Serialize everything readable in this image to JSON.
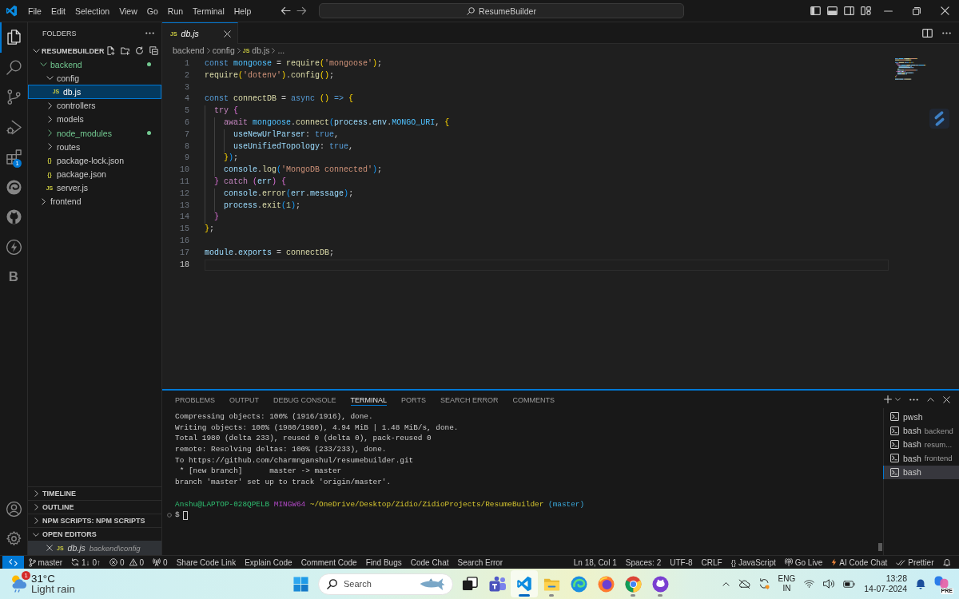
{
  "title_bar": {
    "menu": [
      "File",
      "Edit",
      "Selection",
      "View",
      "Go",
      "Run",
      "Terminal",
      "Help"
    ],
    "search": "ResumeBuilder"
  },
  "activity_bar": {
    "items": [
      {
        "kind": "explorer",
        "selected": true
      },
      {
        "kind": "search",
        "selected": false
      },
      {
        "kind": "source_control",
        "selected": false
      },
      {
        "kind": "run_debug",
        "selected": false
      },
      {
        "kind": "extensions",
        "selected": false,
        "badge": "1"
      },
      {
        "kind": "browser",
        "selected": false
      },
      {
        "kind": "github",
        "selected": false
      },
      {
        "kind": "lightning",
        "selected": false
      },
      {
        "kind": "letter",
        "label": "B",
        "selected": false
      }
    ],
    "bottom": [
      {
        "kind": "account"
      },
      {
        "kind": "settings"
      }
    ]
  },
  "sidebar": {
    "title": "FOLDERS",
    "root": {
      "label": "RESUMEBUILDER",
      "expanded": true
    },
    "tree": [
      {
        "kind": "folder",
        "label": "backend",
        "expanded": true,
        "untracked": true,
        "selected": false,
        "children": [
          {
            "kind": "folder",
            "label": "config",
            "expanded": true,
            "untracked": false,
            "selected": false,
            "children": [
              {
                "kind": "file",
                "icon": "JS",
                "label": "db.js",
                "untracked": false,
                "selected": true
              }
            ]
          },
          {
            "kind": "folder",
            "label": "controllers",
            "expanded": false,
            "untracked": false,
            "selected": false
          },
          {
            "kind": "folder",
            "label": "models",
            "expanded": false,
            "untracked": false,
            "selected": false
          },
          {
            "kind": "folder",
            "label": "node_modules",
            "expanded": false,
            "untracked": true,
            "selected": false
          },
          {
            "kind": "folder",
            "label": "routes",
            "expanded": false,
            "untracked": false,
            "selected": false
          },
          {
            "kind": "file",
            "icon": "{}",
            "label": "package-lock.json",
            "untracked": false,
            "selected": false
          },
          {
            "kind": "file",
            "icon": "{}",
            "label": "package.json",
            "untracked": false,
            "selected": false
          },
          {
            "kind": "file",
            "icon": "JS",
            "label": "server.js",
            "untracked": false,
            "selected": false
          }
        ]
      },
      {
        "kind": "folder",
        "label": "frontend",
        "expanded": false,
        "untracked": false,
        "selected": false
      }
    ],
    "sections": [
      {
        "label": "TIMELINE",
        "expanded": false
      },
      {
        "label": "OUTLINE",
        "expanded": false
      },
      {
        "label": "NPM SCRIPTS: NPM SCRIPTS",
        "expanded": false
      },
      {
        "label": "OPEN EDITORS",
        "expanded": true,
        "items": [
          {
            "icon": "JS",
            "label": "db.js",
            "path": "backend\\config",
            "preview": true,
            "selected": true
          }
        ]
      }
    ]
  },
  "editor": {
    "tabs": [
      {
        "icon": "JS",
        "label": "db.js",
        "preview": true,
        "selected": true
      }
    ],
    "breadcrumbs": [
      {
        "label": "backend"
      },
      {
        "label": "config"
      },
      {
        "icon": "JS",
        "label": "db.js"
      },
      {
        "label": "..."
      }
    ],
    "lines": [
      {
        "number": "1",
        "current": false,
        "tokens": [
          {
            "text": "const",
            "kind": "keyword"
          },
          {
            "text": " mongoose",
            "kind": "constant"
          },
          {
            "text": " = ",
            "kind": "punctuation"
          },
          {
            "text": "require",
            "kind": "function"
          },
          {
            "text": "(",
            "kind": "bracket1"
          },
          {
            "text": "'mongoose'",
            "kind": "string"
          },
          {
            "text": ")",
            "kind": "bracket1"
          },
          {
            "text": ";",
            "kind": "punctuation"
          }
        ]
      },
      {
        "number": "2",
        "current": false,
        "tokens": [
          {
            "text": "require",
            "kind": "function"
          },
          {
            "text": "(",
            "kind": "bracket1"
          },
          {
            "text": "'dotenv'",
            "kind": "string"
          },
          {
            "text": ")",
            "kind": "bracket1"
          },
          {
            "text": ".",
            "kind": "punctuation"
          },
          {
            "text": "config",
            "kind": "function"
          },
          {
            "text": "()",
            "kind": "bracket1"
          },
          {
            "text": ";",
            "kind": "punctuation"
          }
        ]
      },
      {
        "number": "3",
        "current": false
      },
      {
        "number": "4",
        "current": false,
        "tokens": [
          {
            "text": "const",
            "kind": "keyword"
          },
          {
            "text": " connectDB",
            "kind": "function"
          },
          {
            "text": " = ",
            "kind": "punctuation"
          },
          {
            "text": "async",
            "kind": "keyword"
          },
          {
            "text": " ()",
            "kind": "bracket1"
          },
          {
            "text": " =>",
            "kind": "keyword"
          },
          {
            "text": " {",
            "kind": "bracket1"
          }
        ]
      },
      {
        "number": "5",
        "current": false,
        "tokens": [
          {
            "text": "  try",
            "kind": "control"
          },
          {
            "text": " {",
            "kind": "bracket2"
          }
        ]
      },
      {
        "number": "6",
        "current": false,
        "tokens": [
          {
            "text": "    await",
            "kind": "control"
          },
          {
            "text": " mongoose",
            "kind": "constant"
          },
          {
            "text": ".",
            "kind": "punctuation"
          },
          {
            "text": "connect",
            "kind": "function"
          },
          {
            "text": "(",
            "kind": "bracket3"
          },
          {
            "text": "process",
            "kind": "variable"
          },
          {
            "text": ".",
            "kind": "punctuation"
          },
          {
            "text": "env",
            "kind": "variable"
          },
          {
            "text": ".",
            "kind": "punctuation"
          },
          {
            "text": "MONGO_URI",
            "kind": "constant"
          },
          {
            "text": ", ",
            "kind": "punctuation"
          },
          {
            "text": "{",
            "kind": "bracket1"
          }
        ]
      },
      {
        "number": "7",
        "current": false,
        "tokens": [
          {
            "text": "      useNewUrlParser",
            "kind": "variable"
          },
          {
            "text": ": ",
            "kind": "punctuation"
          },
          {
            "text": "true",
            "kind": "keyword"
          },
          {
            "text": ",",
            "kind": "punctuation"
          }
        ]
      },
      {
        "number": "8",
        "current": false,
        "tokens": [
          {
            "text": "      useUnifiedTopology",
            "kind": "variable"
          },
          {
            "text": ": ",
            "kind": "punctuation"
          },
          {
            "text": "true",
            "kind": "keyword"
          },
          {
            "text": ",",
            "kind": "punctuation"
          }
        ]
      },
      {
        "number": "9",
        "current": false,
        "tokens": [
          {
            "text": "    }",
            "kind": "bracket1"
          },
          {
            "text": ")",
            "kind": "bracket3"
          },
          {
            "text": ";",
            "kind": "punctuation"
          }
        ]
      },
      {
        "number": "10",
        "current": false,
        "tokens": [
          {
            "text": "    console",
            "kind": "variable"
          },
          {
            "text": ".",
            "kind": "punctuation"
          },
          {
            "text": "log",
            "kind": "function"
          },
          {
            "text": "(",
            "kind": "bracket3"
          },
          {
            "text": "'MongoDB connected'",
            "kind": "string"
          },
          {
            "text": ")",
            "kind": "bracket3"
          },
          {
            "text": ";",
            "kind": "punctuation"
          }
        ]
      },
      {
        "number": "11",
        "current": false,
        "tokens": [
          {
            "text": "  }",
            "kind": "bracket2"
          },
          {
            "text": " catch",
            "kind": "control"
          },
          {
            "text": " (",
            "kind": "bracket2"
          },
          {
            "text": "err",
            "kind": "variable"
          },
          {
            "text": ")",
            "kind": "bracket2"
          },
          {
            "text": " {",
            "kind": "bracket2"
          }
        ]
      },
      {
        "number": "12",
        "current": false,
        "tokens": [
          {
            "text": "    console",
            "kind": "variable"
          },
          {
            "text": ".",
            "kind": "punctuation"
          },
          {
            "text": "error",
            "kind": "function"
          },
          {
            "text": "(",
            "kind": "bracket3"
          },
          {
            "text": "err",
            "kind": "variable"
          },
          {
            "text": ".",
            "kind": "punctuation"
          },
          {
            "text": "message",
            "kind": "variable"
          },
          {
            "text": ")",
            "kind": "bracket3"
          },
          {
            "text": ";",
            "kind": "punctuation"
          }
        ]
      },
      {
        "number": "13",
        "current": false,
        "tokens": [
          {
            "text": "    process",
            "kind": "variable"
          },
          {
            "text": ".",
            "kind": "punctuation"
          },
          {
            "text": "exit",
            "kind": "function"
          },
          {
            "text": "(",
            "kind": "bracket3"
          },
          {
            "text": "1",
            "kind": "number"
          },
          {
            "text": ")",
            "kind": "bracket3"
          },
          {
            "text": ";",
            "kind": "punctuation"
          }
        ]
      },
      {
        "number": "14",
        "current": false,
        "tokens": [
          {
            "text": "  }",
            "kind": "bracket2"
          }
        ]
      },
      {
        "number": "15",
        "current": false,
        "tokens": [
          {
            "text": "}",
            "kind": "bracket1"
          },
          {
            "text": ";",
            "kind": "punctuation"
          }
        ]
      },
      {
        "number": "16",
        "current": false
      },
      {
        "number": "17",
        "current": false,
        "tokens": [
          {
            "text": "module",
            "kind": "variable"
          },
          {
            "text": ".",
            "kind": "punctuation"
          },
          {
            "text": "exports",
            "kind": "variable"
          },
          {
            "text": " = ",
            "kind": "punctuation"
          },
          {
            "text": "connectDB",
            "kind": "function"
          },
          {
            "text": ";",
            "kind": "punctuation"
          }
        ]
      },
      {
        "number": "18",
        "current": true
      }
    ]
  },
  "panel": {
    "tabs": [
      {
        "label": "PROBLEMS",
        "selected": false
      },
      {
        "label": "OUTPUT",
        "selected": false
      },
      {
        "label": "DEBUG CONSOLE",
        "selected": false
      },
      {
        "label": "TERMINAL",
        "selected": true
      },
      {
        "label": "PORTS",
        "selected": false
      },
      {
        "label": "SEARCH ERROR",
        "selected": false
      },
      {
        "label": "COMMENTS",
        "selected": false
      }
    ],
    "terminal": {
      "output": [
        "Compressing objects: 100% (1916/1916), done.",
        "Writing objects: 100% (1980/1980), 4.94 MiB | 1.48 MiB/s, done.",
        "Total 1980 (delta 233), reused 0 (delta 0), pack-reused 0",
        "remote: Resolving deltas: 100% (233/233), done.",
        "To https://github.com/charmnganshul/resumebuilder.git",
        " * [new branch]      master -> master",
        "branch 'master' set up to track 'origin/master'."
      ],
      "prompt": {
        "user": "Anshu@LAPTOP-028QPELB",
        "shell": "MINGW64",
        "path": "~/OneDrive/Desktop/Zidio/ZidioProjects/ResumeBuilder",
        "branch": "(master)",
        "symbol": "$"
      }
    },
    "instances": [
      {
        "name": "pwsh",
        "selected": false
      },
      {
        "name": "bash",
        "detail": "backend",
        "selected": false
      },
      {
        "name": "bash",
        "detail": "resum...",
        "selected": false
      },
      {
        "name": "bash",
        "detail": "frontend",
        "selected": false
      },
      {
        "name": "bash",
        "selected": true
      }
    ]
  },
  "status_bar": {
    "left": [
      {
        "kind": "remote"
      },
      {
        "kind": "branch",
        "text": "master"
      },
      {
        "kind": "sync",
        "text": "1↓ 0↑"
      },
      {
        "kind": "problems",
        "errors": "0",
        "warnings": "0"
      },
      {
        "kind": "ports",
        "text": "0"
      },
      {
        "kind": "text",
        "text": "Share Code Link"
      },
      {
        "kind": "text",
        "text": "Explain Code"
      },
      {
        "kind": "text",
        "text": "Comment Code"
      },
      {
        "kind": "text",
        "text": "Find Bugs"
      },
      {
        "kind": "text",
        "text": "Code Chat"
      },
      {
        "kind": "text",
        "text": "Search Error"
      }
    ],
    "right": [
      {
        "kind": "text",
        "text": "Ln 18, Col 1"
      },
      {
        "kind": "text",
        "text": "Spaces: 2"
      },
      {
        "kind": "text",
        "text": "UTF-8"
      },
      {
        "kind": "text",
        "text": "CRLF"
      },
      {
        "kind": "language",
        "icon": "{}",
        "text": "JavaScript"
      },
      {
        "kind": "live",
        "text": "Go Live"
      },
      {
        "kind": "ai",
        "text": "AI Code Chat"
      },
      {
        "kind": "formatter",
        "text": "Prettier"
      },
      {
        "kind": "notifications"
      }
    ]
  },
  "taskbar": {
    "weather": {
      "temperature": "31°C",
      "condition": "Light rain",
      "badge": "1"
    },
    "search": {
      "placeholder": "Search"
    },
    "apps": [
      {
        "kind": "task_view",
        "running": false,
        "selected": false
      },
      {
        "kind": "teams",
        "running": false,
        "selected": false
      },
      {
        "kind": "vscode",
        "running": true,
        "selected": true
      },
      {
        "kind": "files",
        "running": true,
        "selected": false
      },
      {
        "kind": "edge",
        "running": false,
        "selected": false
      },
      {
        "kind": "firefox",
        "running": false,
        "selected": false
      },
      {
        "kind": "chrome",
        "running": true,
        "selected": false
      },
      {
        "kind": "github",
        "running": true,
        "selected": false
      }
    ],
    "tray": [
      {
        "kind": "overflow"
      },
      {
        "kind": "cloud"
      },
      {
        "kind": "sync"
      },
      {
        "kind": "language",
        "lines": [
          "ENG",
          "IN"
        ]
      },
      {
        "kind": "wifi"
      },
      {
        "kind": "volume"
      },
      {
        "kind": "battery"
      },
      {
        "kind": "clock",
        "time": "13:28",
        "date": "14-07-2024"
      },
      {
        "kind": "notifications"
      },
      {
        "kind": "copilot",
        "badge": "PRE"
      }
    ]
  }
}
